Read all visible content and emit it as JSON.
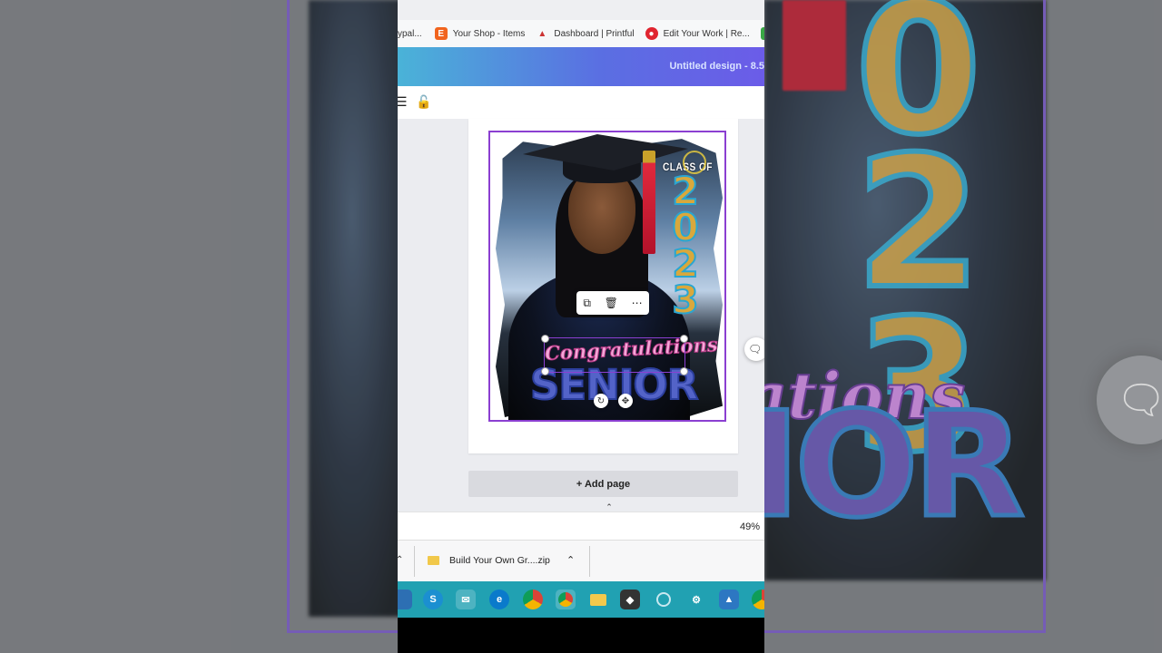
{
  "bookmarks": [
    {
      "label": "ypal...",
      "icon": "bookmark-icon"
    },
    {
      "label": "Your Shop - Items",
      "icon": "etsy-icon"
    },
    {
      "label": "Dashboard | Printful",
      "icon": "printful-icon"
    },
    {
      "label": "Edit Your Work | Re...",
      "icon": "redbubble-icon"
    }
  ],
  "header": {
    "title": "Untitled design - 8.5"
  },
  "toolbar": {
    "icons": [
      "paint-roller-icon",
      "lock-icon"
    ]
  },
  "design": {
    "class_of": "CLASS OF",
    "year": "2023",
    "congrats": "Congratulations",
    "senior": "SENIOR"
  },
  "context_menu": {
    "icons": [
      "duplicate-icon",
      "trash-icon",
      "more-icon"
    ]
  },
  "add_page": "+ Add page",
  "zoom": "49%",
  "download": {
    "filename": "Build Your Own Gr....zip"
  },
  "taskbar": {
    "icons": [
      "edge-icon",
      "skype-icon",
      "mail-icon",
      "edge-icon",
      "chrome-icon",
      "chrome-icon",
      "folder-icon",
      "app-icon",
      "cortana-icon",
      "settings-icon",
      "photos-icon",
      "chrome-icon"
    ]
  },
  "colors": {
    "accent": "#8b3fd1",
    "taskbar": "#21a1b2",
    "header_start": "#4ab3d8",
    "header_end": "#6b5ce8"
  }
}
